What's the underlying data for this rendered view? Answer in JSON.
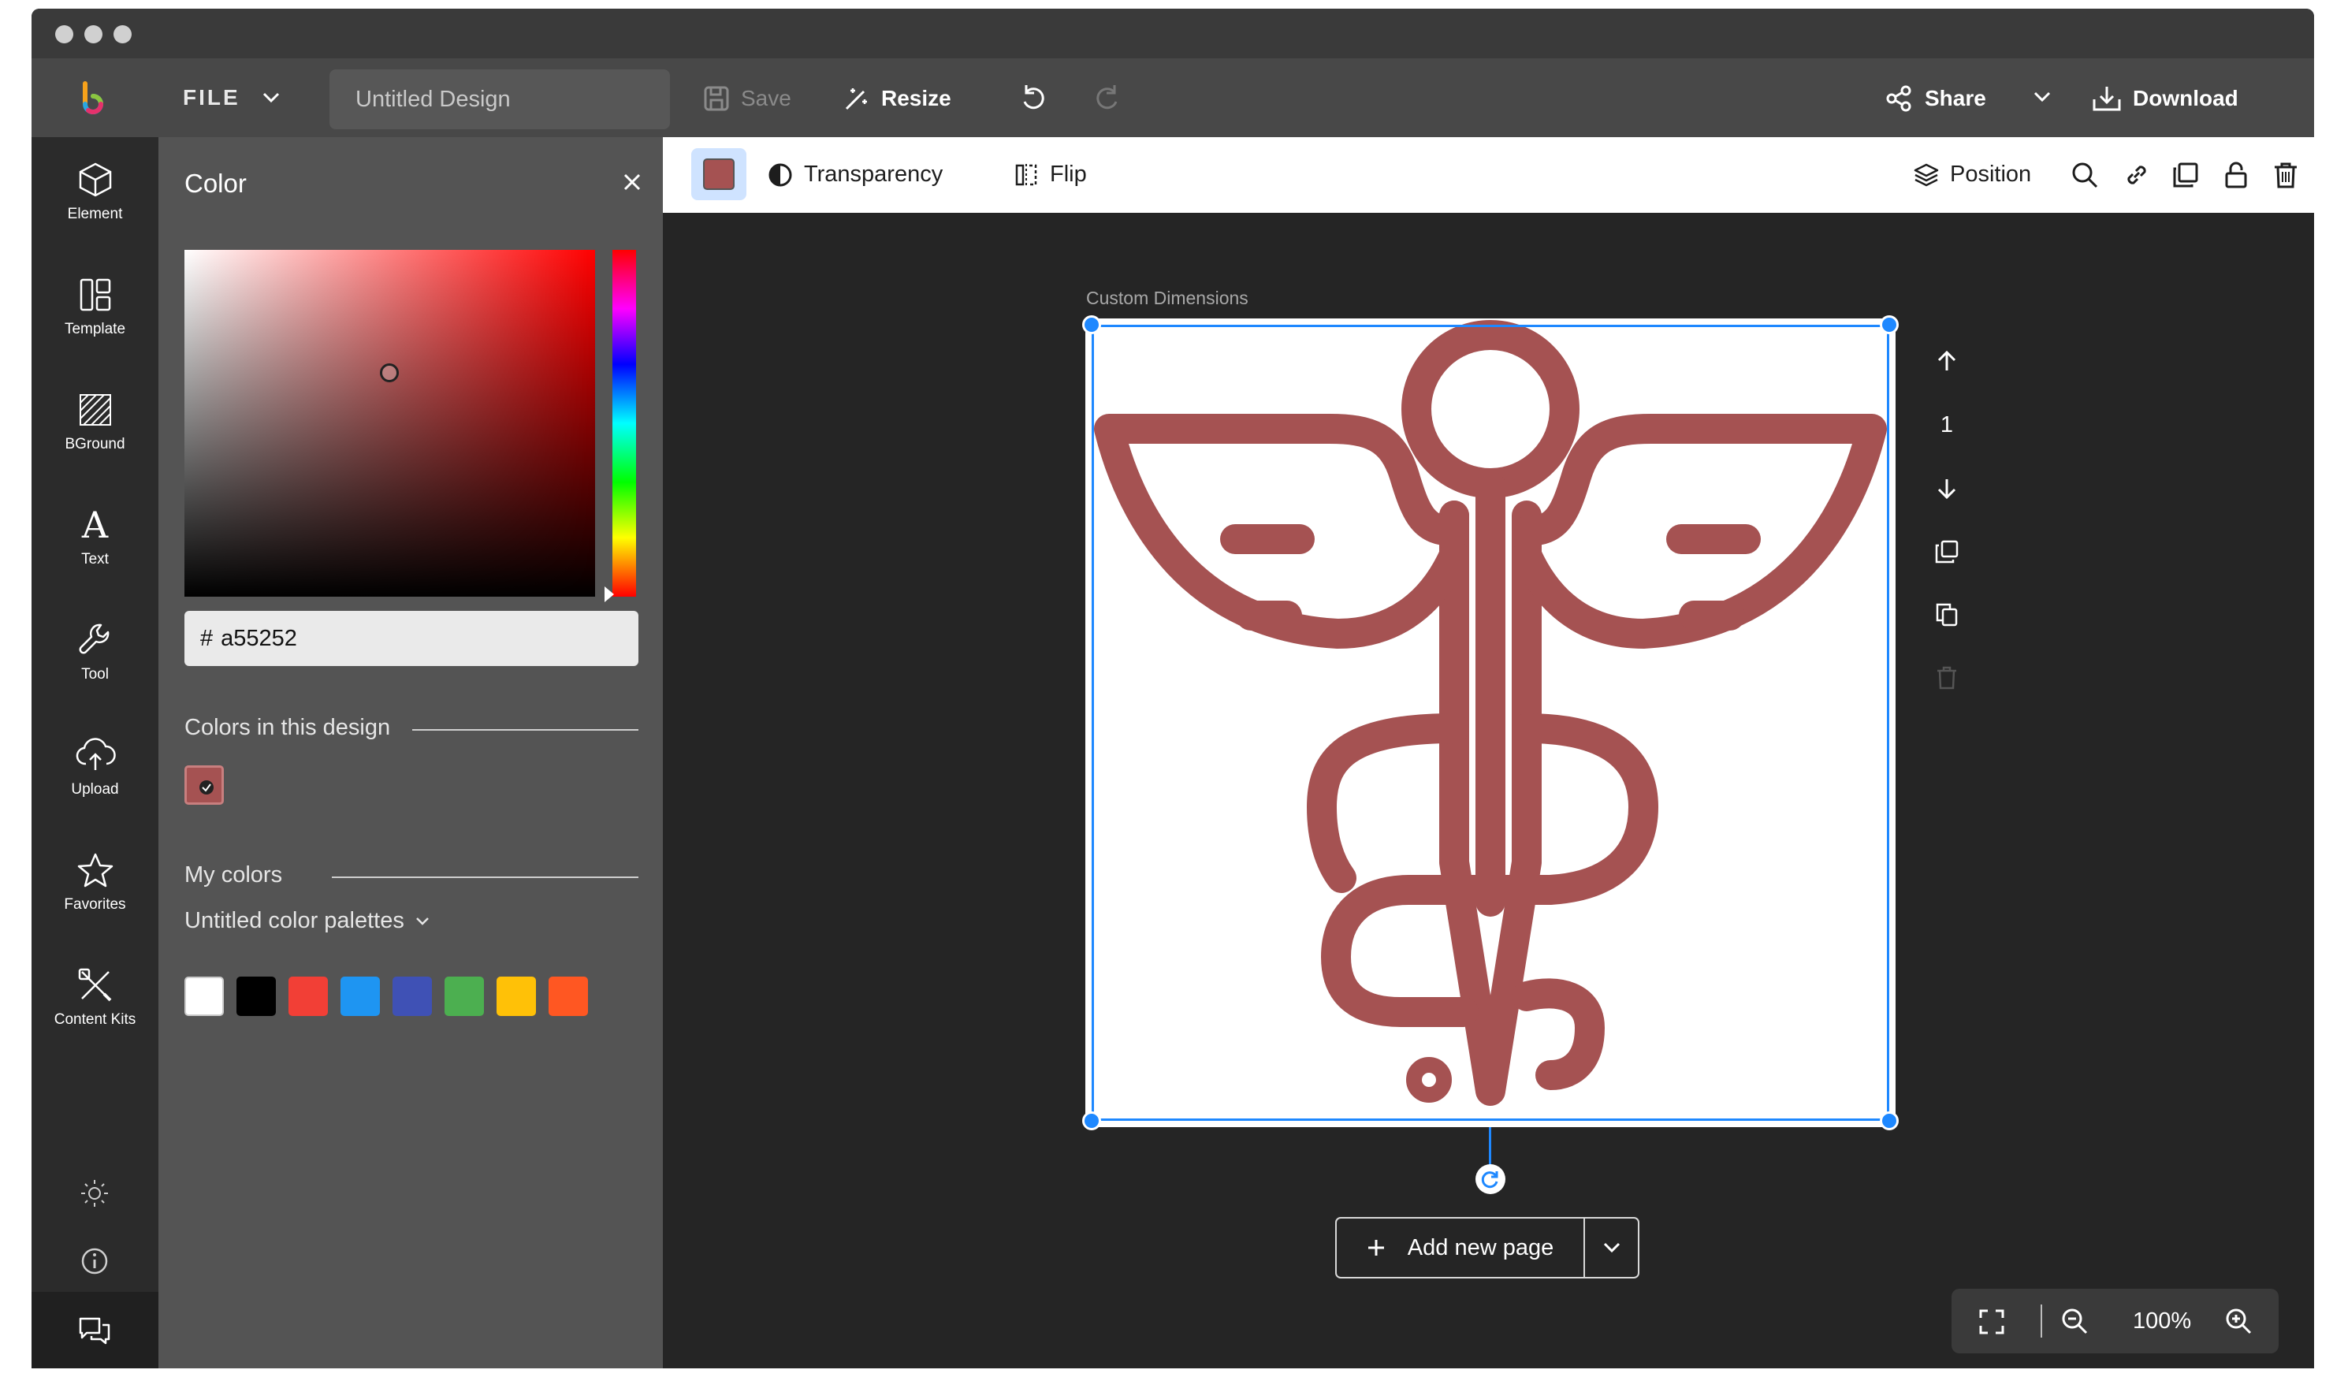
{
  "topbar": {
    "file_label": "FILE",
    "design_name": "Untitled Design",
    "save_label": "Save",
    "resize_label": "Resize",
    "share_label": "Share",
    "download_label": "Download"
  },
  "sidebar": {
    "items": [
      {
        "label": "Element",
        "icon": "cube-icon"
      },
      {
        "label": "Template",
        "icon": "template-icon"
      },
      {
        "label": "BGround",
        "icon": "background-icon"
      },
      {
        "label": "Text",
        "icon": "text-icon"
      },
      {
        "label": "Tool",
        "icon": "wrench-icon"
      },
      {
        "label": "Upload",
        "icon": "cloud-upload-icon"
      },
      {
        "label": "Favorites",
        "icon": "star-icon"
      },
      {
        "label": "Content Kits",
        "icon": "content-kits-icon"
      }
    ]
  },
  "color_panel": {
    "title": "Color",
    "hex_prefix": "#",
    "hex_value": "a55252",
    "colors_in_design_label": "Colors in this design",
    "design_colors": [
      "#a55252"
    ],
    "my_colors_label": "My colors",
    "palette_name": "Untitled color palettes",
    "palette_colors": [
      "#ffffff",
      "#000000",
      "#f23f36",
      "#1e95f2",
      "#3f51b5",
      "#4caf50",
      "#ffc107",
      "#ff5722"
    ]
  },
  "context_bar": {
    "current_color": "#a55252",
    "transparency_label": "Transparency",
    "flip_label": "Flip",
    "position_label": "Position"
  },
  "canvas": {
    "page_label": "Custom Dimensions",
    "page_number": "1",
    "add_page_label": "Add new page",
    "zoom_level": "100%",
    "graphic": "caduceus-icon",
    "graphic_color": "#a55252"
  },
  "colors": {
    "accent": "#1e88ff",
    "panel_bg": "#545454",
    "sidebar_bg": "#2b2b2b",
    "topbar_bg": "#484848"
  }
}
